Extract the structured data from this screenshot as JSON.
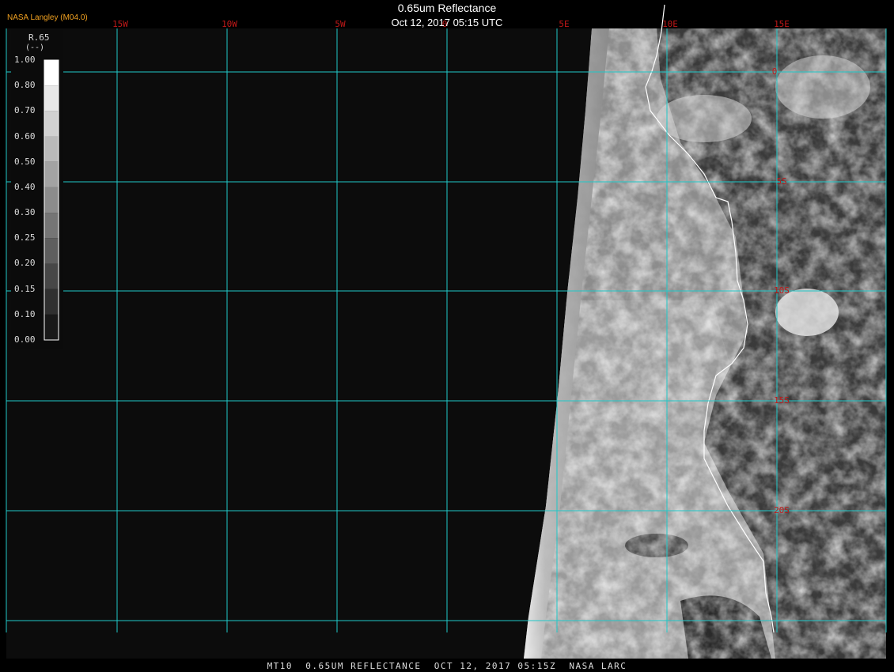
{
  "header": {
    "title": "0.65um Reflectance",
    "datetime": "Oct 12, 2017 05:15 UTC",
    "credit": "NASA Langley (M04.0)"
  },
  "footer": {
    "caption": "MT10  0.65UM REFLECTANCE  OCT 12, 2017 05:15Z  NASA LARC"
  },
  "legend": {
    "variable": "R.65",
    "unit": "(--)",
    "ticks": [
      "1.00",
      "0.80",
      "0.70",
      "0.60",
      "0.50",
      "0.40",
      "0.30",
      "0.25",
      "0.20",
      "0.15",
      "0.10",
      "0.00"
    ]
  },
  "grid": {
    "lon_labels": [
      "15W",
      "10W",
      "5W",
      "0",
      "5E",
      "10E",
      "15E"
    ],
    "lat_labels": [
      "0",
      "5S",
      "10S",
      "15S",
      "20S"
    ]
  },
  "colors": {
    "grid_line": "#20c8c8",
    "grid_label": "#c01818",
    "background": "#0c0c0c",
    "credit": "#f0a020"
  }
}
